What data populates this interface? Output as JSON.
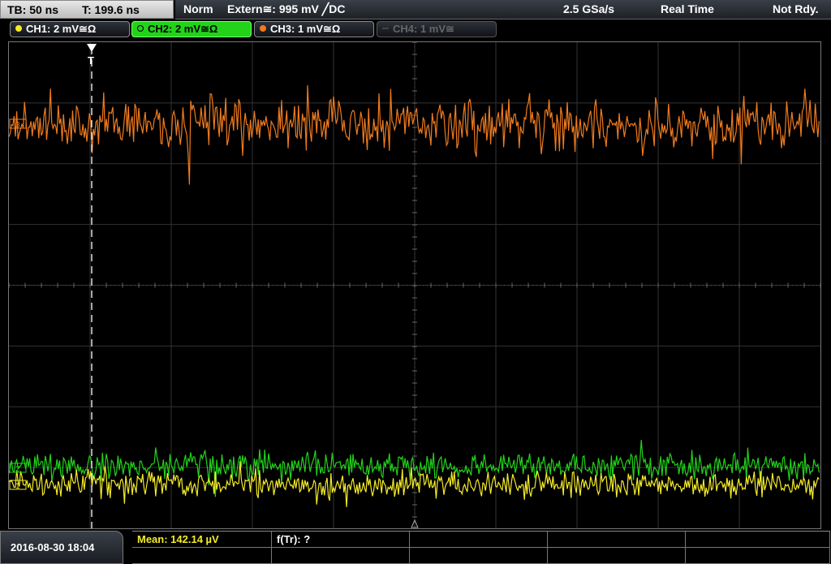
{
  "topbar": {
    "timebase": "TB: 50 ns",
    "trigger_time": "T: 199.6 ns",
    "mode": "Norm",
    "trigger_source": "Extern≅: 995 mV ╱DC",
    "sample_rate": "2.5 GSa/s",
    "acq_mode": "Real Time",
    "trigger_status": "Not Rdy."
  },
  "channels": [
    {
      "label": "CH1: 2 mV≅Ω",
      "color": "#f5ec27",
      "active": false
    },
    {
      "label": "CH2: 2 mV≅Ω",
      "color": "#22d31a",
      "active": true
    },
    {
      "label": "CH3: 1 mV≅Ω",
      "color": "#f07b1e",
      "active": false
    },
    {
      "label": "CH4: 1 mV≅",
      "color": "#555555",
      "active": false
    }
  ],
  "bottom": {
    "datetime": "2016-08-30 18:04",
    "measurement_mean": "Mean: 142.14 µV",
    "measurement_freq": "f(Tr): ?"
  },
  "markers": {
    "trigger_marker": "T",
    "ch3_ref": "3",
    "ch2_ref": "2",
    "ch1_ref": "1"
  },
  "colors": {
    "ch1": "#f5ec27",
    "ch2": "#22d31a",
    "ch3": "#f07b1e",
    "grid": "#3a3a3a",
    "measurement_text": "#f5ec27"
  }
}
